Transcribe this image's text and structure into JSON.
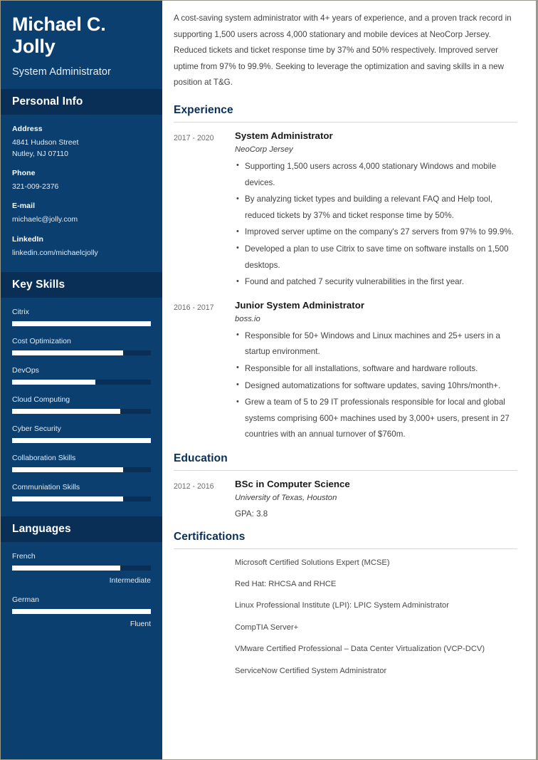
{
  "sidebar": {
    "full_name": "Michael C. Jolly",
    "job_title": "System Administrator",
    "personal_info": {
      "heading": "Personal Info",
      "fields": [
        {
          "label": "Address",
          "value": "4841 Hudson Street\nNutley, NJ 07110"
        },
        {
          "label": "Phone",
          "value": "321-009-2376"
        },
        {
          "label": "E-mail",
          "value": "michaelc@jolly.com"
        },
        {
          "label": "LinkedIn",
          "value": "linkedin.com/michaelcjolly"
        }
      ]
    },
    "key_skills": {
      "heading": "Key Skills",
      "items": [
        {
          "label": "Citrix",
          "level": 100
        },
        {
          "label": "Cost Optimization",
          "level": 80
        },
        {
          "label": "DevOps",
          "level": 60
        },
        {
          "label": "Cloud Computing",
          "level": 78
        },
        {
          "label": "Cyber Security",
          "level": 100
        },
        {
          "label": "Collaboration Skills",
          "level": 80
        },
        {
          "label": "Communiation Skills",
          "level": 80
        }
      ]
    },
    "languages": {
      "heading": "Languages",
      "items": [
        {
          "label": "French",
          "level": 78,
          "caption": "Intermediate"
        },
        {
          "label": "German",
          "level": 100,
          "caption": "Fluent"
        }
      ]
    }
  },
  "main": {
    "summary": "A cost-saving system administrator with 4+ years of experience, and a proven track record in supporting 1,500 users across 4,000 stationary and mobile devices at NeoCorp Jersey. Reduced tickets and ticket response time by 37% and 50% respectively. Improved server uptime from 97% to 99.9%. Seeking to leverage the optimization and saving skills in a new position at T&G.",
    "experience": {
      "heading": "Experience",
      "entries": [
        {
          "date": "2017 - 2020",
          "title": "System Administrator",
          "company": "NeoCorp Jersey",
          "bullets": [
            "Supporting 1,500 users across 4,000 stationary Windows and mobile devices.",
            "By analyzing ticket types and building a relevant FAQ and Help tool, reduced tickets by 37% and ticket response time by 50%.",
            "Improved server uptime on the company's 27 servers from 97% to 99.9%.",
            "Developed a plan to use Citrix to save time on software installs on 1,500 desktops.",
            "Found and patched 7 security vulnerabilities in the first year."
          ]
        },
        {
          "date": "2016 - 2017",
          "title": "Junior System Administrator",
          "company": "boss.io",
          "bullets": [
            "Responsible for 50+ Windows and Linux machines and 25+ users in a startup environment.",
            "Responsible for all installations, software and hardware rollouts.",
            "Designed automatizations for software updates, saving 10hrs/month+.",
            "Grew a team of 5 to 29 IT professionals responsible for local and global systems comprising 600+ machines used by 3,000+ users, present in 27 countries with an annual turnover of $760m."
          ]
        }
      ]
    },
    "education": {
      "heading": "Education",
      "entries": [
        {
          "date": "2012 - 2016",
          "title": "BSc in Computer Science",
          "school": "University of Texas, Houston",
          "gpa": "GPA: 3.8"
        }
      ]
    },
    "certifications": {
      "heading": "Certifications",
      "items": [
        "Microsoft Certified Solutions Expert (MCSE)",
        "Red Hat: RHCSA and RHCE",
        "Linux Professional Institute (LPI): LPIC System Administrator",
        "CompTIA Server+",
        "VMware Certified Professional – Data Center Virtualization (VCP-DCV)",
        "ServiceNow Certified System Administrator"
      ]
    }
  }
}
